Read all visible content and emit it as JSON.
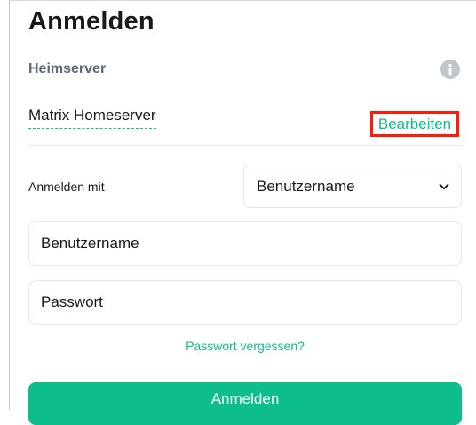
{
  "page": {
    "title": "Anmelden"
  },
  "homeserver": {
    "label": "Heimserver",
    "name": "Matrix Homeserver",
    "edit_label": "Bearbeiten"
  },
  "login_with": {
    "label": "Anmelden mit",
    "selected": "Benutzername"
  },
  "fields": {
    "username_placeholder": "Benutzername",
    "password_placeholder": "Passwort"
  },
  "links": {
    "forgot_password": "Passwort vergessen?"
  },
  "actions": {
    "submit_label": "Anmelden"
  },
  "colors": {
    "accent": "#0dbd8b",
    "highlight_border": "#ff1a0a",
    "muted_text": "#5e6a76",
    "info_icon": "#c1c6cd"
  },
  "icons": {
    "info": "info-icon",
    "dropdown": "chevron-down-icon"
  }
}
